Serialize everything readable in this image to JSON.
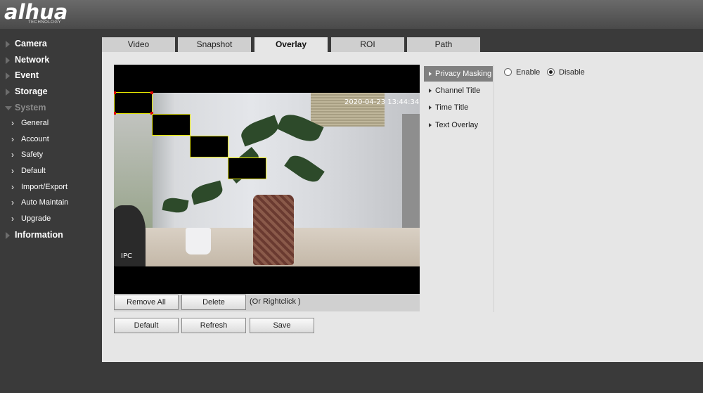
{
  "brand": {
    "name": "alhua",
    "tagline": "TECHNOLOGY"
  },
  "sidebar": {
    "top": [
      {
        "label": "Camera"
      },
      {
        "label": "Network"
      },
      {
        "label": "Event"
      },
      {
        "label": "Storage"
      },
      {
        "label": "System"
      }
    ],
    "system_items": [
      {
        "label": "General"
      },
      {
        "label": "Account"
      },
      {
        "label": "Safety"
      },
      {
        "label": "Default"
      },
      {
        "label": "Import/Export"
      },
      {
        "label": "Auto Maintain"
      },
      {
        "label": "Upgrade"
      }
    ],
    "information": "Information"
  },
  "tabs": [
    {
      "label": "Video"
    },
    {
      "label": "Snapshot"
    },
    {
      "label": "Overlay",
      "active": true
    },
    {
      "label": "ROI"
    },
    {
      "label": "Path"
    }
  ],
  "video": {
    "timestamp": "2020-04-23 13:44:34",
    "channel_title": "IPC"
  },
  "video_buttons": {
    "remove_all": "Remove All",
    "delete": "Delete",
    "hint": "(Or Rightclick )"
  },
  "actions": {
    "default": "Default",
    "refresh": "Refresh",
    "save": "Save"
  },
  "overlay_menu": [
    {
      "label": "Privacy Masking",
      "active": true
    },
    {
      "label": "Channel Title"
    },
    {
      "label": "Time Title"
    },
    {
      "label": "Text Overlay"
    }
  ],
  "privacy_masking": {
    "enable_label": "Enable",
    "disable_label": "Disable",
    "selected": "Disable"
  },
  "colors": {
    "mask_border": "#e6e600",
    "mask_handle": "#e00000",
    "active_menu_bg": "#808080"
  }
}
